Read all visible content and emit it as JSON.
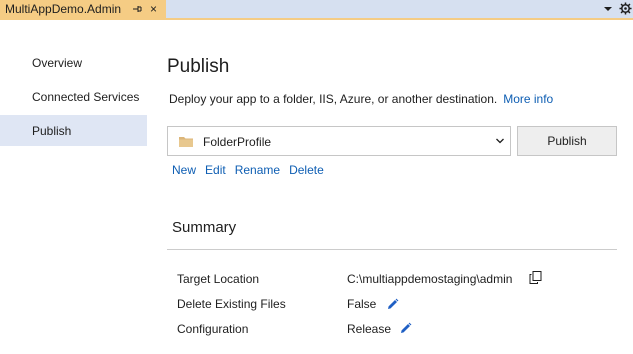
{
  "tab": {
    "title": "MultiAppDemo.Admin",
    "close_glyph": "×"
  },
  "nav": {
    "items": [
      {
        "label": "Overview"
      },
      {
        "label": "Connected Services"
      },
      {
        "label": "Publish",
        "selected": true
      }
    ]
  },
  "main": {
    "title": "Publish",
    "description": "Deploy your app to a folder, IIS, Azure, or another destination.",
    "more_info": "More info",
    "profile": "FolderProfile",
    "publish_button": "Publish",
    "actions": [
      "New",
      "Edit",
      "Rename",
      "Delete"
    ]
  },
  "summary": {
    "title": "Summary",
    "rows": [
      {
        "label": "Target Location",
        "value": "C:\\multiappdemostaging\\admin"
      },
      {
        "label": "Delete Existing Files",
        "value": "False"
      },
      {
        "label": "Configuration",
        "value": "Release"
      }
    ]
  },
  "colors": {
    "tab_active": "#f5cc84",
    "tab_strip": "#d6e0f0",
    "nav_selected": "#dfe6f4",
    "link": "#0e5eb3",
    "pencil": "#1f5fc4"
  }
}
